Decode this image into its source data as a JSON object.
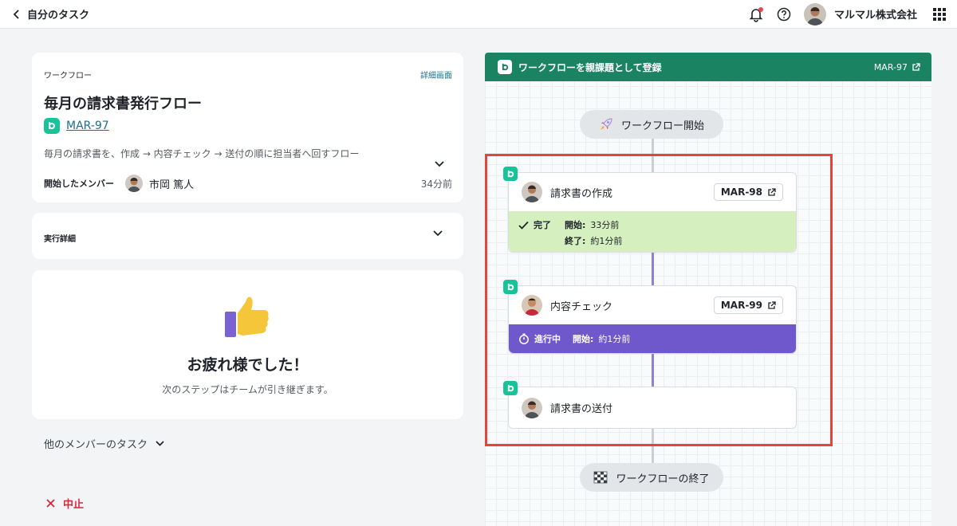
{
  "topbar": {
    "back_label": "自分のタスク",
    "company": "マルマル株式会社"
  },
  "workflow_card": {
    "section_label": "ワークフロー",
    "detail_link": "詳細画面",
    "title": "毎月の請求書発行フロー",
    "key": "MAR-97",
    "description": "毎月の請求書を、作成 → 内容チェック → 送付の順に担当者へ回すフロー",
    "started_by_label": "開始したメンバー",
    "started_by": "市岡 篤人",
    "started_ago": "34分前"
  },
  "execution_card": {
    "label": "実行詳細"
  },
  "done_card": {
    "message": "お疲れ様でした！",
    "sub": "次のステップはチームが引き継ぎます。"
  },
  "others_label": "他のメンバーのタスク",
  "abort_label": "中止",
  "flow": {
    "header_title": "ワークフローを親課題として登録",
    "header_key": "MAR-97",
    "start_label": "ワークフロー開始",
    "end_label": "ワークフローの終了",
    "tasks": [
      {
        "name": "請求書の作成",
        "key": "MAR-98",
        "status": "完了",
        "start_label": "開始:",
        "start_value": "33分前",
        "end_label": "終了:",
        "end_value": "約1分前"
      },
      {
        "name": "内容チェック",
        "key": "MAR-99",
        "status": "進行中",
        "start_label": "開始:",
        "start_value": "約1分前"
      },
      {
        "name": "請求書の送付"
      }
    ]
  },
  "colors": {
    "brand_green": "#18c39a",
    "header_green": "#1a8462",
    "done_bg": "#d5efbe",
    "progress_bg": "#6f58cb",
    "highlight": "#e2463a",
    "link": "#1f6f8b",
    "danger": "#d7263d"
  }
}
